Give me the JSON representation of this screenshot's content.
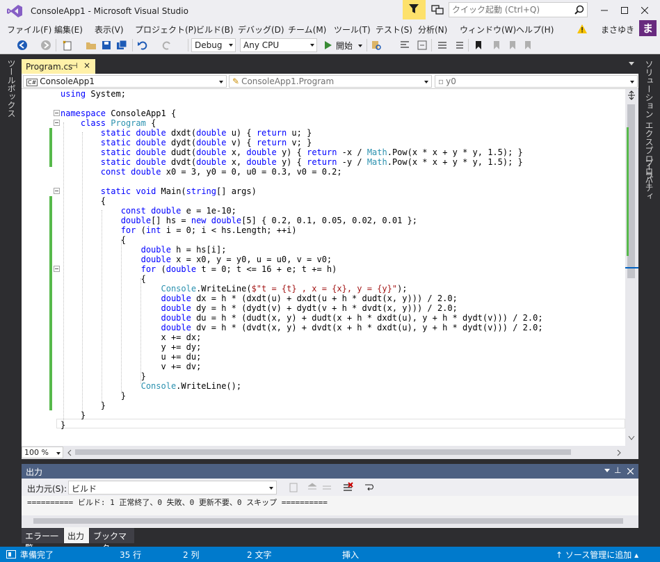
{
  "window": {
    "title": "ConsoleApp1 - Microsoft Visual Studio",
    "min": "minimize",
    "max": "maximize",
    "close": "close"
  },
  "quick_launch": {
    "placeholder": "クイック起動 (Ctrl+Q)"
  },
  "menu": [
    "ファイル(F)",
    "編集(E)",
    "表示(V)",
    "プロジェクト(P)",
    "ビルド(B)",
    "デバッグ(D)",
    "チーム(M)",
    "ツール(T)",
    "テスト(S)",
    "分析(N)",
    "ウィンドウ(W)",
    "ヘルプ(H)"
  ],
  "user": {
    "name": "まさゆき",
    "avatar_letter": "ま"
  },
  "toolbar": {
    "config": "Debug",
    "platform": "Any CPU",
    "start_label": "開始"
  },
  "side_tabs": {
    "left": "ツールボックス",
    "right_top": "ソリューション エクスプローラー",
    "right_bottom": "プロパティ"
  },
  "doc_tab": {
    "name": "Program.cs",
    "pin": "⊣",
    "close": "×"
  },
  "nav": {
    "project": "ConsoleApp1",
    "class": "ConsoleApp1.Program",
    "member": "y0"
  },
  "code_lines": [
    "using System;",
    "",
    "namespace ConsoleApp1 {",
    "    class Program {",
    "        static double dxdt(double u) { return u; }",
    "        static double dydt(double v) { return v; }",
    "        static double dudt(double x, double y) { return -x / Math.Pow(x * x + y * y, 1.5); }",
    "        static double dvdt(double x, double y) { return -y / Math.Pow(x * x + y * y, 1.5); }",
    "        const double x0 = 3, y0 = 0, u0 = 0.3, v0 = 0.2;",
    "",
    "        static void Main(string[] args)",
    "        {",
    "            const double e = 1e-10;",
    "            double[] hs = new double[5] { 0.2, 0.1, 0.05, 0.02, 0.01 };",
    "            for (int i = 0; i < hs.Length; ++i)",
    "            {",
    "                double h = hs[i];",
    "                double x = x0, y = y0, u = u0, v = v0;",
    "                for (double t = 0; t <= 16 + e; t += h)",
    "                {",
    "                    Console.WriteLine($\"t = {t} , x = {x}, y = {y}\");",
    "                    double dx = h * (dxdt(u) + dxdt(u + h * dudt(x, y))) / 2.0;",
    "                    double dy = h * (dydt(v) + dydt(v + h * dvdt(x, y))) / 2.0;",
    "                    double du = h * (dudt(x, y) + dudt(x + h * dxdt(u), y + h * dydt(v))) / 2.0;",
    "                    double dv = h * (dvdt(x, y) + dvdt(x + h * dxdt(u), y + h * dydt(v))) / 2.0;",
    "                    x += dx;",
    "                    y += dy;",
    "                    u += du;",
    "                    v += dv;",
    "                }",
    "                Console.WriteLine();",
    "            }",
    "        }",
    "    }",
    "}"
  ],
  "editor": {
    "zoom": "100 %"
  },
  "output": {
    "title": "出力",
    "source_label": "出力元(S):",
    "source": "ビルド",
    "text": "========== ビルド: 1 正常終了、0 失敗、0 更新不要、0 スキップ =========="
  },
  "bottom_tabs": [
    "エラー一覧",
    "出力",
    "ブックマーク"
  ],
  "status": {
    "ready": "準備完了",
    "line": "35 行",
    "col": "2 列",
    "chars": "2 文字",
    "mode": "挿入",
    "scc": "ソース管理に追加"
  }
}
